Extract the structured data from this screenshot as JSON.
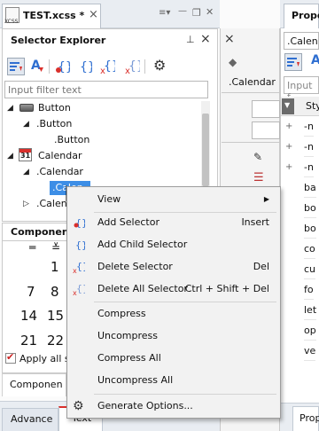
{
  "editor_tab": {
    "title": "TEST.xcss *",
    "file_icon_text": "XCSS",
    "close": "×",
    "menu_glyph": "≡▾",
    "minimize": "—",
    "maximize": "❐",
    "close_window": "✕"
  },
  "selector_explorer": {
    "title": "Selector Explorer",
    "pin": "⊥",
    "close": "×",
    "toolbar_glyphs": {
      "sort_az": "A"
    },
    "filter_placeholder": "Input filter text",
    "tree": [
      {
        "label": "Button",
        "icon": "button-icon",
        "expanded": true
      },
      {
        "label": ".Button",
        "expanded": true
      },
      {
        "label": ".Button"
      },
      {
        "label": "Calendar",
        "icon": "calendar-icon",
        "expanded": true
      },
      {
        "label": ".Calendar",
        "expanded": true
      },
      {
        "label": ".Calen",
        "selected": true
      },
      {
        "label": ".Calen",
        "expanded": false
      }
    ],
    "calendar_icon_number": "31"
  },
  "component_panel": {
    "title": "Componen",
    "calendar_numbers": [
      "1",
      "7",
      "8",
      "14",
      "15",
      "21",
      "22"
    ],
    "apply_label": "Apply all s",
    "bottom_tab": "Componen"
  },
  "bottom_tabs": {
    "advance": "Advance",
    "text": "Text"
  },
  "middle_panel": {
    "label": ".Calendar"
  },
  "right_panel": {
    "tab_title": "Prope",
    "selector_field": ".Calen",
    "sort_label": "A",
    "filter_placeholder": "Input f",
    "column_header": "Sty",
    "rows": [
      "-n",
      "-n",
      "-n",
      "ba",
      "bo",
      "bo",
      "co",
      "cu",
      "fo",
      "let",
      "op",
      "ve"
    ],
    "bottom_tab": "Prop"
  },
  "context_menu": {
    "items": [
      {
        "label": "View",
        "shortcut": "",
        "submenu_arrow": "▶"
      },
      {
        "label": "Add Selector",
        "shortcut": "Insert"
      },
      {
        "label": "Add Child Selector",
        "shortcut": ""
      },
      {
        "label": "Delete Selector",
        "shortcut": "Del"
      },
      {
        "label": "Delete All Selector",
        "shortcut": "Ctrl + Shift + Del"
      },
      {
        "label": "Compress",
        "shortcut": ""
      },
      {
        "label": "Uncompress",
        "shortcut": ""
      },
      {
        "label": "Compress All",
        "shortcut": ""
      },
      {
        "label": "Uncompress All",
        "shortcut": ""
      },
      {
        "label": "Generate Options...",
        "shortcut": ""
      }
    ]
  },
  "colors": {
    "selection": "#3d8ee6",
    "accent_blue": "#2f6fd1",
    "accent_red": "#d9302c"
  }
}
